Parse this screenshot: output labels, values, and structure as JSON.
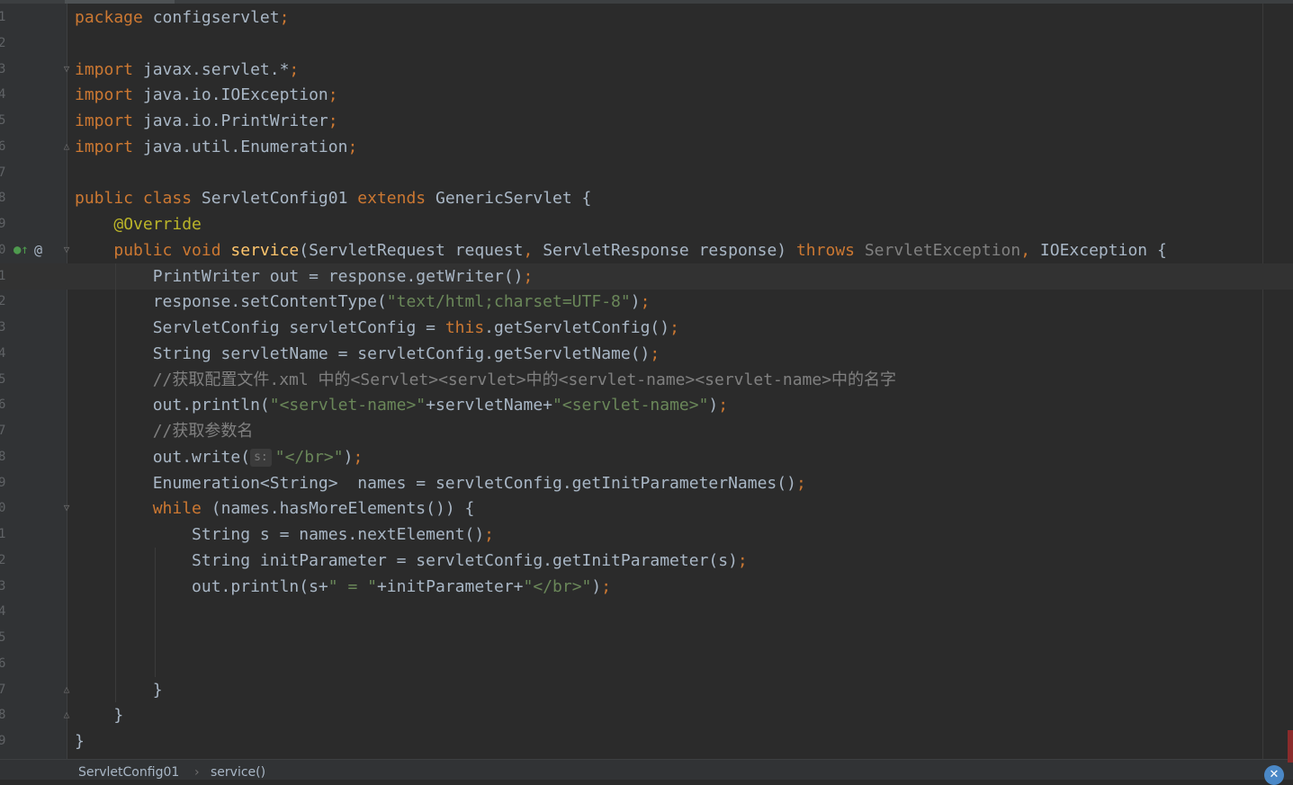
{
  "editor": {
    "line_numbers": [
      "1",
      "2",
      "3",
      "4",
      "5",
      "6",
      "7",
      "8",
      "9",
      "0",
      "1",
      "2",
      "3",
      "4",
      "5",
      "6",
      "7",
      "8",
      "9",
      "0",
      "1",
      "2",
      "3",
      "4",
      "5",
      "6",
      "7",
      "8",
      "9"
    ],
    "lines": [
      [
        {
          "t": "package ",
          "c": "kw"
        },
        {
          "t": "configservlet"
        },
        {
          "t": ";",
          "c": "kw"
        }
      ],
      [],
      [
        {
          "t": "import ",
          "c": "kw"
        },
        {
          "t": "javax.servlet.*"
        },
        {
          "t": ";",
          "c": "kw"
        }
      ],
      [
        {
          "t": "import ",
          "c": "kw"
        },
        {
          "t": "java.io.IOException"
        },
        {
          "t": ";",
          "c": "kw"
        }
      ],
      [
        {
          "t": "import ",
          "c": "kw"
        },
        {
          "t": "java.io.PrintWriter"
        },
        {
          "t": ";",
          "c": "kw"
        }
      ],
      [
        {
          "t": "import ",
          "c": "kw"
        },
        {
          "t": "java.util.Enumeration"
        },
        {
          "t": ";",
          "c": "kw"
        }
      ],
      [],
      [
        {
          "t": "public class ",
          "c": "kw"
        },
        {
          "t": "ServletConfig01 "
        },
        {
          "t": "extends ",
          "c": "kw"
        },
        {
          "t": "GenericServlet {"
        }
      ],
      [
        {
          "t": "    "
        },
        {
          "t": "@Override",
          "c": "ann"
        }
      ],
      [
        {
          "t": "    "
        },
        {
          "t": "public void ",
          "c": "kw"
        },
        {
          "t": "service",
          "c": "fn"
        },
        {
          "t": "(ServletRequest request"
        },
        {
          "t": ", ",
          "c": "kw"
        },
        {
          "t": "ServletResponse response) "
        },
        {
          "t": "throws ",
          "c": "kw"
        },
        {
          "t": "ServletException",
          "c": "cmt"
        },
        {
          "t": ", ",
          "c": "kw"
        },
        {
          "t": "IOException {"
        }
      ],
      [
        {
          "t": "        PrintWriter out = response.getWriter()"
        },
        {
          "t": ";",
          "c": "kw"
        }
      ],
      [
        {
          "t": "        response.setContentType("
        },
        {
          "t": "\"text/html;charset=UTF-8\"",
          "c": "str"
        },
        {
          "t": ")"
        },
        {
          "t": ";",
          "c": "kw"
        }
      ],
      [
        {
          "t": "        ServletConfig servletConfig = "
        },
        {
          "t": "this",
          "c": "kw"
        },
        {
          "t": ".getServletConfig()"
        },
        {
          "t": ";",
          "c": "kw"
        }
      ],
      [
        {
          "t": "        String servletName = servletConfig.getServletName()"
        },
        {
          "t": ";",
          "c": "kw"
        }
      ],
      [
        {
          "t": "        //获取配置文件.xml 中的<Servlet><servlet>中的<servlet-name><servlet-name>中的名字",
          "c": "cmt"
        }
      ],
      [
        {
          "t": "        out.println("
        },
        {
          "t": "\"<servlet-name>\"",
          "c": "str"
        },
        {
          "t": "+servletName+"
        },
        {
          "t": "\"<servlet-name>\"",
          "c": "str"
        },
        {
          "t": ")"
        },
        {
          "t": ";",
          "c": "kw"
        }
      ],
      [
        {
          "t": "        //获取参数名",
          "c": "cmt"
        }
      ],
      [
        {
          "t": "        out.write("
        },
        {
          "t": "s:",
          "c": "hint"
        },
        {
          "t": "\"</br>\"",
          "c": "str"
        },
        {
          "t": ")"
        },
        {
          "t": ";",
          "c": "kw"
        }
      ],
      [
        {
          "t": "        Enumeration<String>  names = servletConfig.getInitParameterNames()"
        },
        {
          "t": ";",
          "c": "kw"
        }
      ],
      [
        {
          "t": "        "
        },
        {
          "t": "while ",
          "c": "kw"
        },
        {
          "t": "(names.hasMoreElements()) {"
        }
      ],
      [
        {
          "t": "            String s = names.nextElement()"
        },
        {
          "t": ";",
          "c": "kw"
        }
      ],
      [
        {
          "t": "            String initParameter = servletConfig.getInitParameter(s)"
        },
        {
          "t": ";",
          "c": "kw"
        }
      ],
      [
        {
          "t": "            out.println(s+"
        },
        {
          "t": "\" = \"",
          "c": "str"
        },
        {
          "t": "+initParameter+"
        },
        {
          "t": "\"</br>\"",
          "c": "str"
        },
        {
          "t": ")"
        },
        {
          "t": ";",
          "c": "kw"
        }
      ],
      [],
      [],
      [],
      [
        {
          "t": "        }"
        }
      ],
      [
        {
          "t": "    }"
        }
      ],
      [
        {
          "t": "}"
        }
      ]
    ],
    "current_line": 10
  },
  "breadcrumb": {
    "class_name": "ServletConfig01",
    "separator": "›",
    "method_name": "service()"
  }
}
